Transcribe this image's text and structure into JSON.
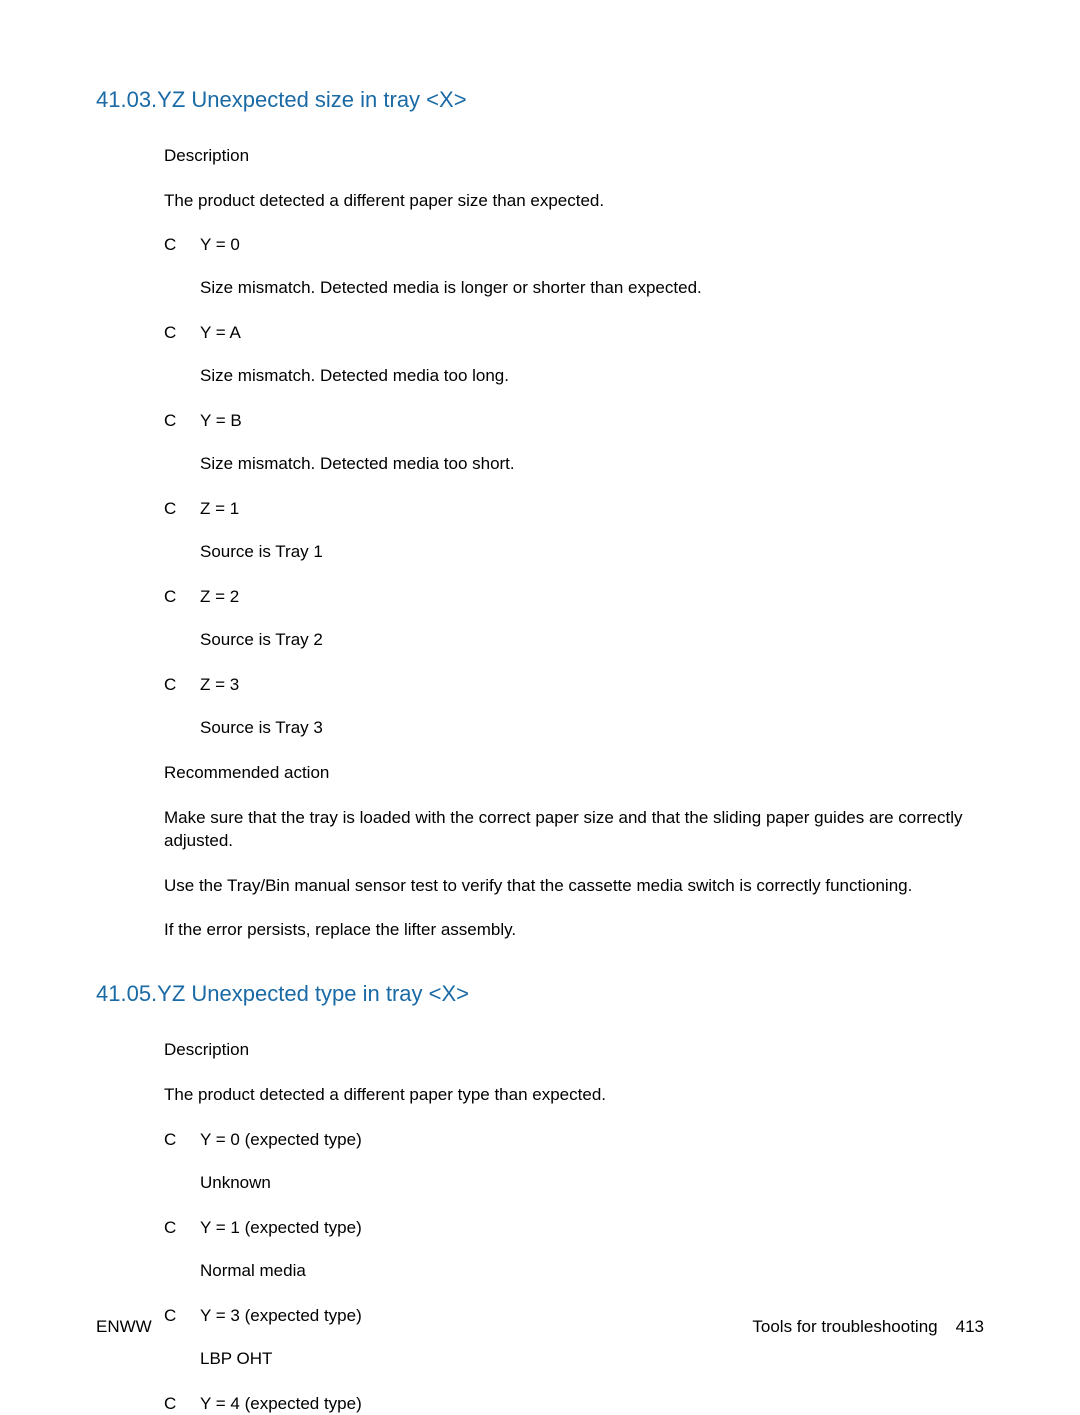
{
  "sections": [
    {
      "heading": "41.03.YZ Unexpected size in tray <X>",
      "description_label": "Description",
      "description_text": "The product detected a different paper size than expected.",
      "bullets": [
        {
          "marker": "C",
          "label": "Y = 0",
          "detail": "Size mismatch. Detected media is longer or shorter than expected."
        },
        {
          "marker": "C",
          "label": "Y = A",
          "detail": "Size mismatch. Detected media too long."
        },
        {
          "marker": "C",
          "label": "Y = B",
          "detail": "Size mismatch. Detected media too short."
        },
        {
          "marker": "C",
          "label": "Z = 1",
          "detail": "Source is Tray 1"
        },
        {
          "marker": "C",
          "label": "Z = 2",
          "detail": "Source is Tray 2"
        },
        {
          "marker": "C",
          "label": "Z = 3",
          "detail": "Source is Tray 3"
        }
      ],
      "recommended_label": "Recommended action",
      "recommended_paras": [
        "Make sure that the tray is loaded with the correct paper size and that the sliding paper guides are correctly adjusted.",
        "Use the Tray/Bin manual sensor test to verify that the cassette media switch is correctly functioning.",
        "If the error persists, replace the lifter assembly."
      ]
    },
    {
      "heading": "41.05.YZ Unexpected type in tray <X>",
      "description_label": "Description",
      "description_text": "The product detected a different paper type than expected.",
      "bullets": [
        {
          "marker": "C",
          "label": "Y = 0 (expected type)",
          "detail": "Unknown"
        },
        {
          "marker": "C",
          "label": "Y = 1 (expected type)",
          "detail": "Normal media"
        },
        {
          "marker": "C",
          "label": "Y = 3 (expected type)",
          "detail": "LBP OHT"
        },
        {
          "marker": "C",
          "label": "Y = 4 (expected type)",
          "detail": ""
        }
      ],
      "recommended_label": "",
      "recommended_paras": []
    }
  ],
  "footer": {
    "left": "ENWW",
    "right_text": "Tools for troubleshooting",
    "page_number": "413"
  }
}
